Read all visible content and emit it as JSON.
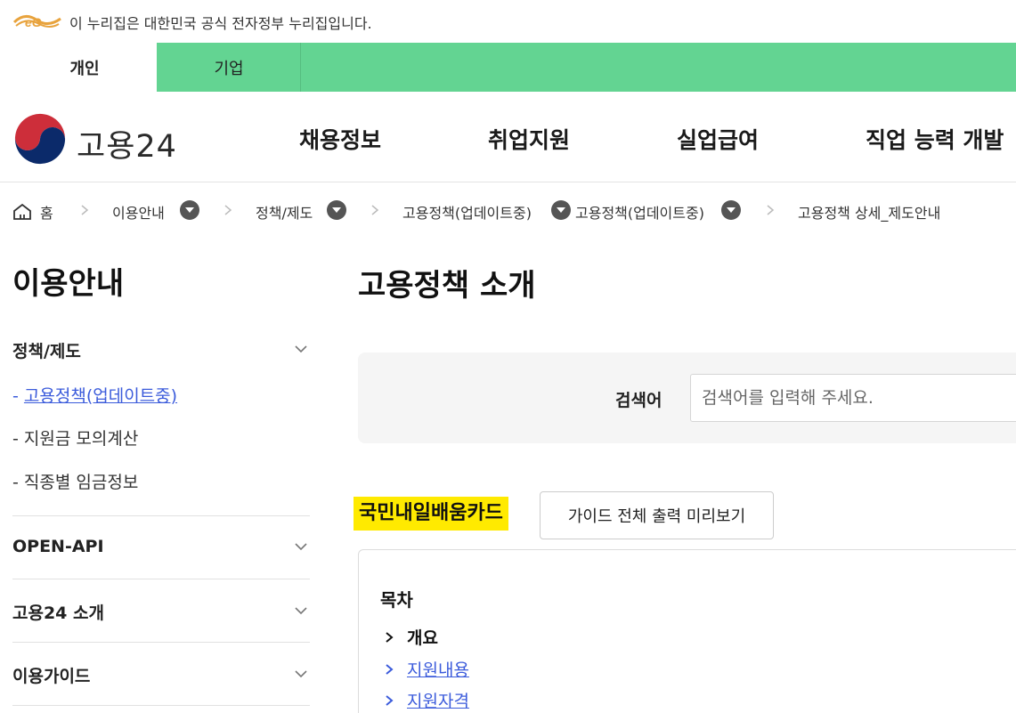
{
  "gov_banner": {
    "text": "이 누리집은 대한민국 공식 전자정부 누리집입니다."
  },
  "user_tabs": [
    {
      "label": "개인",
      "active": true
    },
    {
      "label": "기업",
      "active": false
    }
  ],
  "logo": {
    "text": "고용24"
  },
  "gnb": [
    "채용정보",
    "취업지원",
    "실업급여",
    "직업 능력 개발"
  ],
  "breadcrumb": [
    "홈",
    "이용안내",
    "정책/제도",
    "고용정책(업데이트중)",
    "고용정책(업데이트중)",
    "고용정책 상세_제도안내"
  ],
  "sidebar": {
    "title": "이용안내",
    "groups": [
      {
        "label": "정책/제도",
        "sub": [
          "고용정책(업데이트중)",
          "지원금 모의계산",
          "직종별 임금정보"
        ]
      },
      {
        "label": "OPEN-API"
      },
      {
        "label": "고용24 소개"
      },
      {
        "label": "이용가이드"
      }
    ]
  },
  "main": {
    "title": "고용정책 소개",
    "search": {
      "label": "검색어",
      "placeholder": "검색어를 입력해 주세요."
    },
    "card_title": "국민내일배움카드",
    "guide_button": "가이드 전체 출력 미리보기",
    "toc": {
      "title": "목차",
      "items": [
        "개요",
        "지원내용",
        "지원자격"
      ]
    }
  },
  "colors": {
    "tab_green": "#63d492",
    "highlight": "#ffea00",
    "link": "#3b5bdb"
  }
}
